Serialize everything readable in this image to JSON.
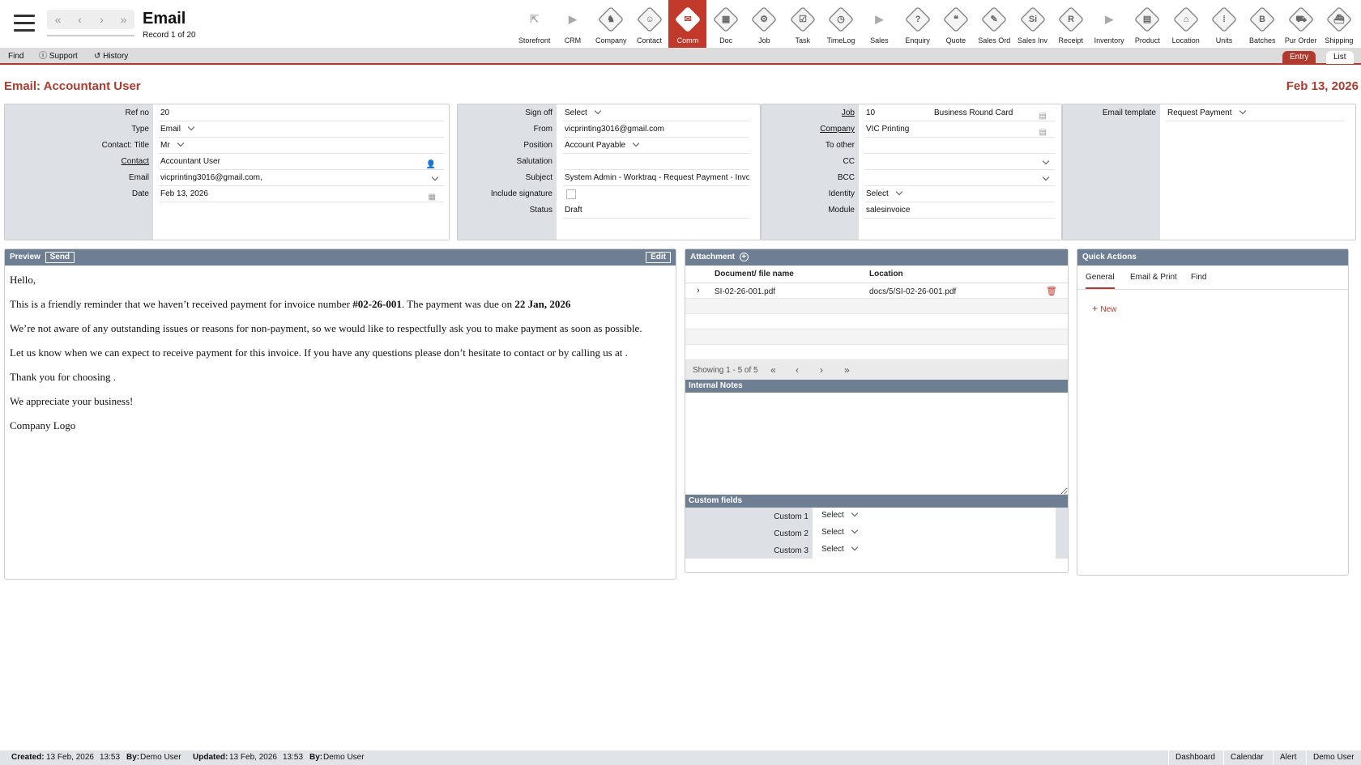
{
  "header": {
    "title": "Email",
    "record": "Record 1 of 20",
    "nav": [
      "«",
      "‹",
      "›",
      "»"
    ]
  },
  "modules": [
    {
      "label": "Storefront",
      "glyph": "⇱",
      "plain": true
    },
    {
      "label": "CRM",
      "glyph": "▶",
      "plain": true
    },
    {
      "label": "Company",
      "glyph": "♞"
    },
    {
      "label": "Contact",
      "glyph": "☺"
    },
    {
      "label": "Comm",
      "glyph": "✉",
      "active": true
    },
    {
      "label": "Doc",
      "glyph": "▦"
    },
    {
      "label": "Job",
      "glyph": "⚙"
    },
    {
      "label": "Task",
      "glyph": "☑"
    },
    {
      "label": "TimeLog",
      "glyph": "◷"
    },
    {
      "label": "Sales",
      "glyph": "▶",
      "plain": true
    },
    {
      "label": "Enquiry",
      "glyph": "?"
    },
    {
      "label": "Quote",
      "glyph": "❝"
    },
    {
      "label": "Sales Ord",
      "glyph": "✎"
    },
    {
      "label": "Sales Inv",
      "glyph": "Si"
    },
    {
      "label": "Receipt",
      "glyph": "R"
    },
    {
      "label": "Inventory",
      "glyph": "▶",
      "plain": true
    },
    {
      "label": "Product",
      "glyph": "▤"
    },
    {
      "label": "Location",
      "glyph": "⌂"
    },
    {
      "label": "Units",
      "glyph": "⁞"
    },
    {
      "label": "Batches",
      "glyph": "B"
    },
    {
      "label": "Pur Order",
      "glyph": "⛟"
    },
    {
      "label": "Shipping",
      "glyph": "⛴"
    }
  ],
  "menu": {
    "find": "Find",
    "support": "Support",
    "history": "History",
    "entry": "Entry",
    "list": "List"
  },
  "page": {
    "heading": "Email: Accountant User",
    "date": "Feb 13, 2026"
  },
  "panel1": [
    {
      "label": "Ref no",
      "value": "20"
    },
    {
      "label": "Type",
      "value": "Email",
      "select": true
    },
    {
      "label": "Contact: Title",
      "value": "Mr",
      "select": true
    },
    {
      "label": "Contact",
      "value": "Accountant User",
      "link": true,
      "icon": "person-icon"
    },
    {
      "label": "Email",
      "value": "vicprinting3016@gmail.com,",
      "rchev": true
    },
    {
      "label": "Date",
      "value": "Feb 13, 2026",
      "icon": "calendar-icon"
    }
  ],
  "panel2": [
    {
      "label": "Sign off",
      "value": "Select",
      "select": true
    },
    {
      "label": "From",
      "value": "vicprinting3016@gmail.com"
    },
    {
      "label": "Position",
      "value": "Account Payable",
      "select": true
    },
    {
      "label": "Salutation",
      "value": ""
    },
    {
      "label": "Subject",
      "value": "System Admin - Worktraq - Request Payment - Invo"
    },
    {
      "label": "Include signature",
      "value": "",
      "checkbox": true
    },
    {
      "label": "Status",
      "value": "Draft"
    }
  ],
  "panel3": [
    {
      "label": "Job",
      "value": "10",
      "extra": "Business Round Card",
      "link": true,
      "icon": "doc-icon"
    },
    {
      "label": "Company",
      "value": "VIC Printing",
      "link": true,
      "icon": "doc-icon"
    },
    {
      "label": "To other",
      "value": ""
    },
    {
      "label": "CC",
      "value": "",
      "rchev": true
    },
    {
      "label": "BCC",
      "value": "",
      "rchev": true
    },
    {
      "label": "Identity",
      "value": "Select",
      "select": true
    },
    {
      "label": "Module",
      "value": "salesinvoice"
    }
  ],
  "panel4": [
    {
      "label": "Email template",
      "value": "Request Payment",
      "select": true
    }
  ],
  "preview": {
    "label": "Preview",
    "send": "Send",
    "edit": "Edit",
    "p1": "Hello,",
    "p2a": "This is a friendly reminder that we haven’t received payment for invoice number ",
    "p2b": "#02-26-001",
    "p2c": ". The payment was due on ",
    "p2d": "22 Jan, 2026",
    "p3": "We’re not aware of any outstanding issues or reasons for non-payment, so we would like to respectfully ask you to make payment as soon as possible.",
    "p4": "Let us know when we can expect to receive payment for this invoice. If you have any questions please don’t hesitate to contact or by calling us at .",
    "p5": "Thank you for choosing .",
    "p6": "We appreciate your business!",
    "logo": "Company Logo"
  },
  "attachment": {
    "title": "Attachment",
    "col1": "Document/ file name",
    "col2": "Location",
    "rows": [
      {
        "name": "SI-02-26-001.pdf",
        "location": "docs/5/SI-02-26-001.pdf"
      }
    ],
    "showing": "Showing 1 - 5 of 5",
    "pager": [
      "«",
      "‹",
      "›",
      "»"
    ]
  },
  "notes": {
    "title": "Internal Notes"
  },
  "custom": {
    "title": "Custom fields",
    "rows": [
      {
        "label": "Custom 1",
        "value": "Select"
      },
      {
        "label": "Custom 2",
        "value": "Select"
      },
      {
        "label": "Custom 3",
        "value": "Select"
      }
    ]
  },
  "quick": {
    "title": "Quick Actions",
    "tabs": [
      "General",
      "Email & Print",
      "Find"
    ],
    "new": "New"
  },
  "status": {
    "created_l": "Created:",
    "created_v": "13 Feb, 2026",
    "created_t": "13:53",
    "by1_l": "By:",
    "by1_v": "Demo User",
    "updated_l": "Updated:",
    "updated_v": "13 Feb, 2026",
    "updated_t": "13:53",
    "by2_l": "By:",
    "by2_v": "Demo User",
    "buttons": [
      "Dashboard",
      "Calendar",
      "Alert",
      "Demo User"
    ]
  },
  "colors": {
    "accent": "#b03a2e",
    "header": "#6e7f93"
  }
}
